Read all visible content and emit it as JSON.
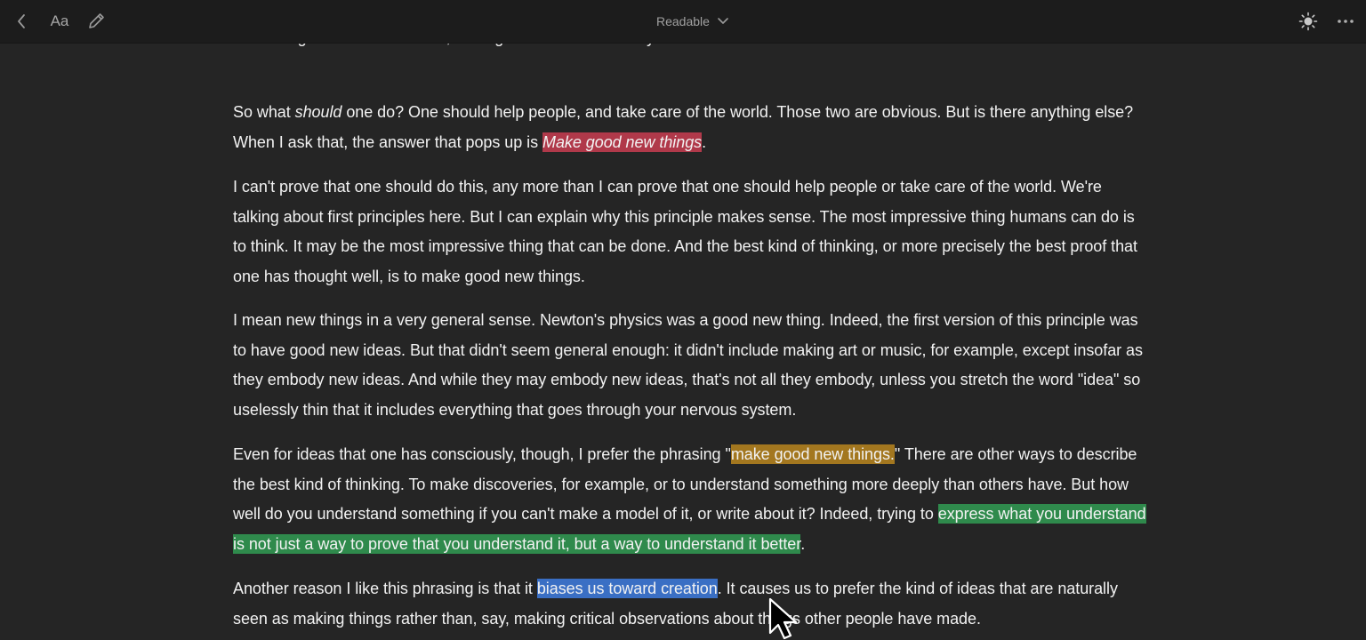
{
  "toolbar": {
    "back_icon": "chevron-left-icon",
    "font_label": "Aa",
    "annotate_icon": "pencil-icon",
    "title": "Readable",
    "title_icon": "chevron-down-icon",
    "theme_icon": "sun-icon",
    "more_icon": "ellipsis-icon"
  },
  "highlight_colors": {
    "red": "#b0394a",
    "yellow": "#a3771f",
    "green": "#2f8a4c",
    "blue": "#3a6fc4"
  },
  "article": {
    "p0": "something else. But once I did, I thought I should at least try to answer it.",
    "p1": {
      "a": "So what ",
      "em": "should",
      "b": " one do? One should help people, and take care of the world. Those two are obvious. But is there anything else? When I ask that, the answer that pops up is ",
      "highlight": "Make good new things",
      "c": "."
    },
    "p2": "I can't prove that one should do this, any more than I can prove that one should help people or take care of the world. We're talking about first principles here. But I can explain why this principle makes sense. The most impressive thing humans can do is to think. It may be the most impressive thing that can be done. And the best kind of thinking, or more precisely the best proof that one has thought well, is to make good new things.",
    "p3": "I mean new things in a very general sense. Newton's physics was a good new thing. Indeed, the first version of this principle was to have good new ideas. But that didn't seem general enough: it didn't include making art or music, for example, except insofar as they embody new ideas. And while they may embody new ideas, that's not all they embody, unless you stretch the word \"idea\" so uselessly thin that it includes everything that goes through your nervous system.",
    "p4": {
      "a": "Even for ideas that one has consciously, though, I prefer the phrasing \"",
      "highlight_yellow": "make good new things.",
      "b": "\" There are other ways to describe the best kind of thinking. To make discoveries, for example, or to understand something more deeply than others have. But how well do you understand something if you can't make a model of it, or write about it? Indeed, trying to ",
      "highlight_green": "express what you understand is not just a way to prove that you understand it, but a way to understand it better",
      "c": "."
    },
    "p5": {
      "a": "Another reason I like this phrasing is that it ",
      "highlight_blue": "biases us toward creation",
      "b": ". It causes us to prefer the kind of ideas that are naturally seen as making things rather than, say, making critical observations about things other people have made."
    }
  },
  "cursor_icon": "mouse-pointer-icon"
}
